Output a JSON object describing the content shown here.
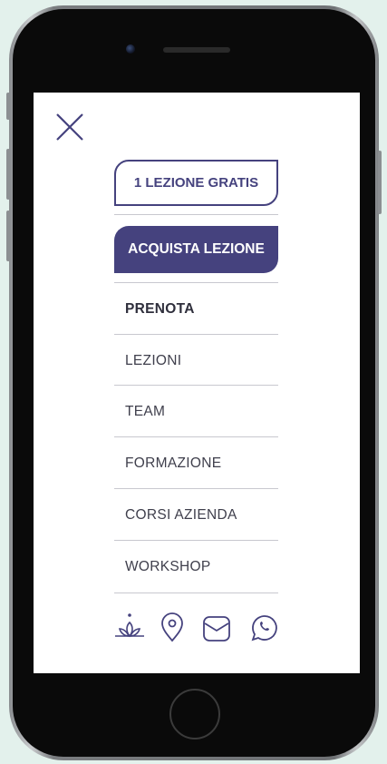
{
  "menu": {
    "cta_free": "1 LEZIONE GRATIS",
    "cta_buy": "ACQUISTA LEZIONE",
    "items": [
      {
        "label": "PRENOTA"
      },
      {
        "label": "LEZIONI"
      },
      {
        "label": "TEAM"
      },
      {
        "label": "FORMAZIONE"
      },
      {
        "label": "CORSI AZIENDA"
      },
      {
        "label": "WORKSHOP"
      }
    ]
  },
  "icons": [
    "close-icon",
    "lotus-icon",
    "location-pin-icon",
    "mail-icon",
    "whatsapp-icon"
  ],
  "colors": {
    "accent": "#45427e",
    "divider": "#c8c8cf",
    "text": "#3f3f4c",
    "background": "#e3f1ec"
  }
}
